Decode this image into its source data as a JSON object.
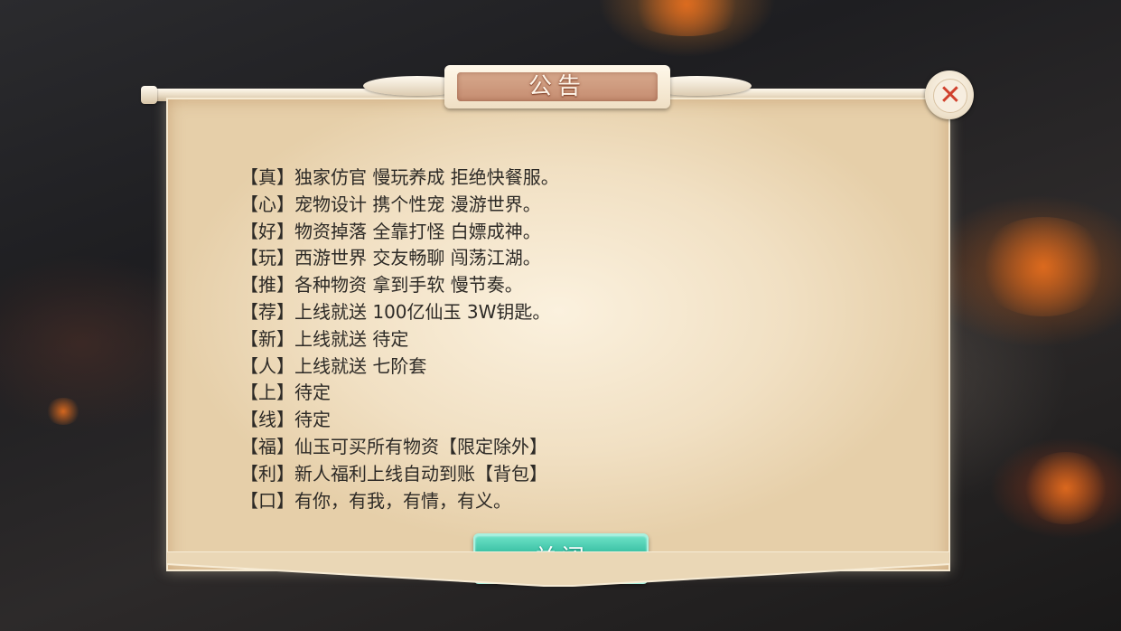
{
  "dialog": {
    "title": "公告",
    "close_icon_glyph": "✕",
    "lines": [
      "【真】独家仿官 慢玩养成 拒绝快餐服。",
      "【心】宠物设计 携个性宠 漫游世界。",
      "【好】物资掉落 全靠打怪 白嫖成神。",
      "【玩】西游世界 交友畅聊 闯荡江湖。",
      "【推】各种物资 拿到手软 慢节奏。",
      "【荐】上线就送 100亿仙玉 3W钥匙。",
      "【新】上线就送 待定",
      "【人】上线就送 七阶套",
      "【上】待定",
      "【线】待定",
      "【福】仙玉可买所有物资【限定除外】",
      "【利】新人福利上线自动到账【背包】",
      "【口】有你，有我，有情，有义。"
    ],
    "close_button_label": "关闭"
  },
  "colors": {
    "button_accent": "#2fb99c",
    "close_icon": "#d0402c",
    "title_plaque": "#c58c70"
  }
}
